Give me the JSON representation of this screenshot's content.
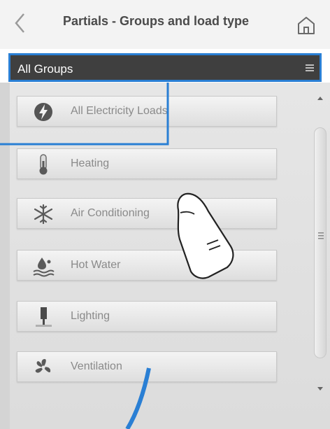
{
  "header": {
    "title": "Partials - Groups and load type"
  },
  "group_selector": {
    "label": "All Groups"
  },
  "load_types": [
    {
      "label": "All Electricity Loads",
      "icon": "lightning-icon"
    },
    {
      "label": "Heating",
      "icon": "thermometer-icon"
    },
    {
      "label": "Air Conditioning",
      "icon": "snowflake-icon"
    },
    {
      "label": "Hot Water",
      "icon": "water-drop-waves-icon"
    },
    {
      "label": "Lighting",
      "icon": "lamp-icon"
    },
    {
      "label": "Ventilation",
      "icon": "fan-icon"
    }
  ],
  "colors": {
    "highlight": "#2a7fd4",
    "group_bar": "#3f3f3f",
    "item_text": "#8a8a8a"
  }
}
